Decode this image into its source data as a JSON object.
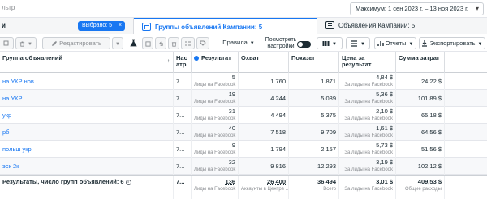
{
  "search": {
    "fragment": "льтр"
  },
  "date_range": {
    "label": "Максимум: 1 сен 2023 г. – 13 ноя 2023 г."
  },
  "tabs": {
    "campaigns_fragment": "и",
    "selected_pill": "Выбрано: 5",
    "adsets": "Группы объявлений Кампании: 5",
    "ads": "Объявления Кампании: 5"
  },
  "toolbar": {
    "edit": "Редактировать",
    "rules": "Правила",
    "view_settings": "Посмотреть настройки",
    "reports": "Отчеты",
    "export": "Экспортировать"
  },
  "columns": {
    "name": "Группа объявлений",
    "delivery": "Нас\nатр",
    "results": "Результат",
    "reach": "Охват",
    "impressions": "Показы",
    "cost_per_result": "Цена за\nрезультат",
    "amount_spent": "Сумма затрат"
  },
  "rows": [
    {
      "name": "на УКР нов",
      "delivery": "7...",
      "results": "5",
      "results_sub": "Лиды на Facebook",
      "reach": "1 760",
      "impressions": "1 871",
      "cpr": "4,84 $",
      "cpr_sub": "За лиды на Facebook",
      "spent": "24,22 $"
    },
    {
      "name": "на УКР",
      "delivery": "7...",
      "results": "19",
      "results_sub": "Лиды на Facebook",
      "reach": "4 244",
      "impressions": "5 089",
      "cpr": "5,36 $",
      "cpr_sub": "За лиды на Facebook",
      "spent": "101,89 $"
    },
    {
      "name": "укр",
      "delivery": "7...",
      "results": "31",
      "results_sub": "Лиды на Facebook",
      "reach": "4 494",
      "impressions": "5 375",
      "cpr": "2,10 $",
      "cpr_sub": "За лиды на Facebook",
      "spent": "65,18 $"
    },
    {
      "name": "рб",
      "delivery": "7...",
      "results": "40",
      "results_sub": "Лиды на Facebook",
      "reach": "7 518",
      "impressions": "9 709",
      "cpr": "1,61 $",
      "cpr_sub": "За лиды на Facebook",
      "spent": "64,56 $"
    },
    {
      "name": "польш укр",
      "delivery": "7...",
      "results": "9",
      "results_sub": "Лиды на Facebook",
      "reach": "1 794",
      "impressions": "2 157",
      "cpr": "5,73 $",
      "cpr_sub": "За лиды на Facebook",
      "spent": "51,56 $"
    },
    {
      "name": "эск 2к",
      "delivery": "7...",
      "results": "32",
      "results_sub": "Лиды на Facebook",
      "reach": "9 816",
      "impressions": "12 293",
      "cpr": "3,19 $",
      "cpr_sub": "За лиды на Facebook",
      "spent": "102,12 $"
    }
  ],
  "totals": {
    "label": "Результаты, число групп объявлений: 6",
    "delivery": "7...",
    "results": "136",
    "results_sub": "Лиды на Facebook",
    "reach": "26 400",
    "reach_sub": "Аккаунты в Центре ...",
    "impressions": "36 494",
    "impressions_sub": "Всего",
    "cpr": "3,01 $",
    "cpr_sub": "За лиды на Facebook",
    "spent": "409,53 $",
    "spent_sub": "Общие расходы"
  }
}
